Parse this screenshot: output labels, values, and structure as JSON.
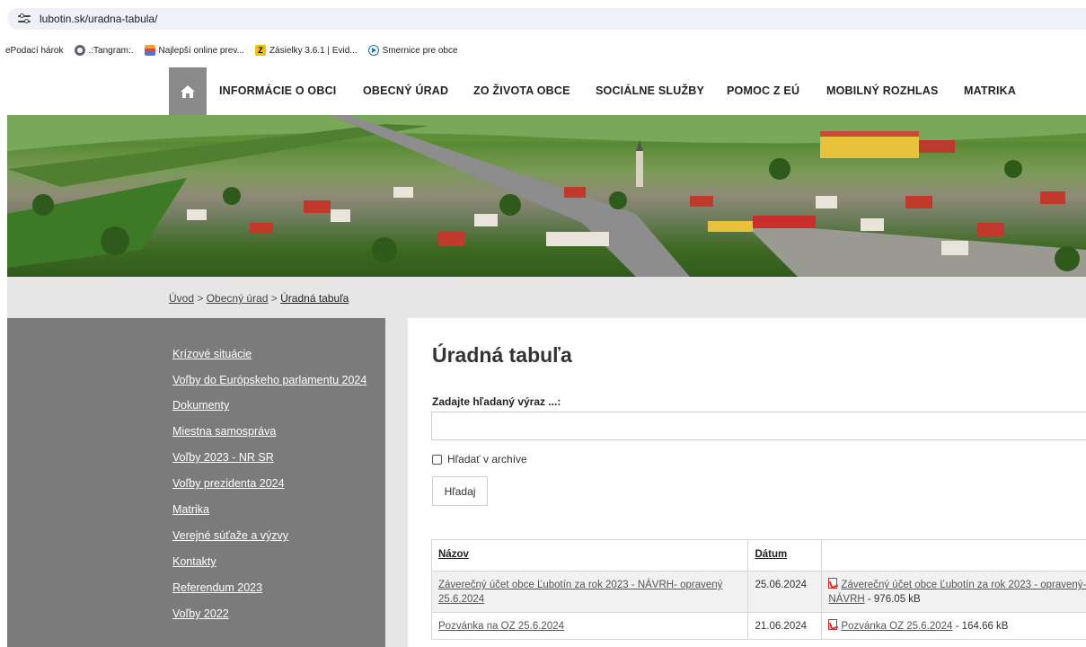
{
  "browser": {
    "url": "lubotin.sk/uradna-tabula/",
    "bookmarks": [
      {
        "label": "ePodací hárok",
        "icon": "none"
      },
      {
        "label": ".:Tangram:.",
        "icon": "globe-icon"
      },
      {
        "label": "Najlepší online prev...",
        "icon": "stack-icon"
      },
      {
        "label": "Zásielky 3.6.1 | Evid...",
        "icon": "z-icon"
      },
      {
        "label": "Smernice pre obce",
        "icon": "circle-play-icon"
      }
    ]
  },
  "nav": {
    "home_icon": "home-icon",
    "items": [
      "INFORMÁCIE O OBCI",
      "OBECNÝ ÚRAD",
      "ZO ŽIVOTA OBCE",
      "SOCIÁLNE SLUŽBY",
      "POMOC Z EÚ",
      "MOBILNÝ ROZHLAS",
      "MATRIKA"
    ]
  },
  "breadcrumb": {
    "items": [
      "Úvod",
      "Obecný úrad",
      "Úradná tabuľa"
    ],
    "separator": ">"
  },
  "sidebar": {
    "items": [
      "Krízové situácie",
      "Voľby do Európskeho parlamentu 2024",
      "Dokumenty",
      "Miestna samospráva",
      "Voľby 2023 - NR SR",
      "Voľby prezidenta 2024",
      "Matrika",
      "Verejné súťaže a výzvy",
      "Kontakty",
      "Referendum 2023",
      "Voľby 2022"
    ]
  },
  "main": {
    "title": "Úradná tabuľa",
    "search_label": "Zadajte hľadaný výraz ...:",
    "search_value": "",
    "archive_label": "Hľadať v archíve",
    "archive_checked": false,
    "search_button": "Hľadaj",
    "table": {
      "headers": [
        "Názov",
        "Dátum",
        ""
      ],
      "rows": [
        {
          "name": "Záverečný účet obce Ľubotín za rok 2023 - NÁVRH- opravený 25.6.2024",
          "date": "25.06.2024",
          "file_link": "Záverečný účet obce Ľubotín za rok 2023 - opravený- NÁVRH",
          "file_size": "- 976.05 kB"
        },
        {
          "name": "Pozvánka na OZ 25.6.2024",
          "date": "21.06.2024",
          "file_link": "Pozvánka OZ 25.6.2024",
          "file_size": "- 164.66 kB"
        }
      ]
    }
  },
  "colors": {
    "sidebar_bg": "#7b7b7b",
    "home_button_bg": "#8a8a8a",
    "crumb_bar_bg": "#e6e6e6",
    "pdf_icon": "#d9342f"
  }
}
